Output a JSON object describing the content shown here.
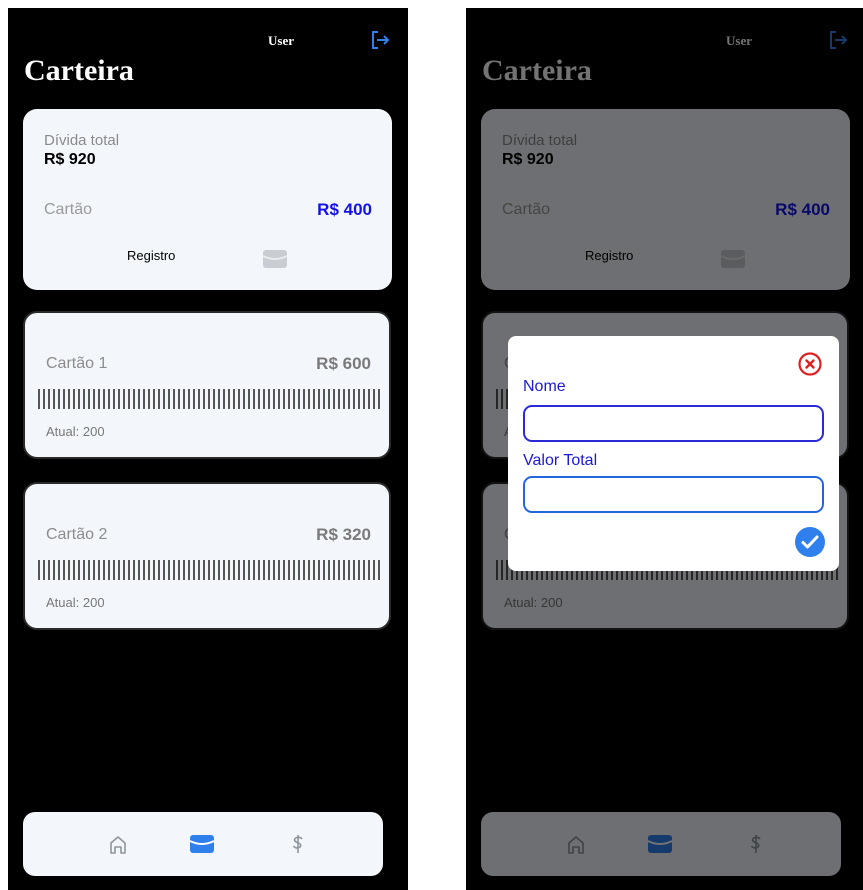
{
  "app": {
    "user_label": "User",
    "title": "Carteira"
  },
  "summary": {
    "total_label": "Dívida total",
    "total_value": "R$ 920",
    "card_label": "Cartão",
    "card_value": "R$ 400",
    "registro_label": "Registro"
  },
  "cards": [
    {
      "name": "Cartão 1",
      "value": "R$ 600",
      "atual": "Atual: 200"
    },
    {
      "name": "Cartão 2",
      "value": "R$ 320",
      "atual": "Atual: 200"
    }
  ],
  "nav": {
    "items": [
      {
        "icon": "home-icon",
        "active": false
      },
      {
        "icon": "wallet-icon",
        "active": true
      },
      {
        "icon": "dollar-icon",
        "active": false
      }
    ]
  },
  "modal": {
    "nome_label": "Nome",
    "nome_value": "",
    "valor_label": "Valor Total",
    "valor_value": ""
  },
  "colors": {
    "accent": "#1212e6",
    "nav_active": "#2f80ed",
    "close_red": "#e02020",
    "confirm_blue": "#2f80ed"
  }
}
